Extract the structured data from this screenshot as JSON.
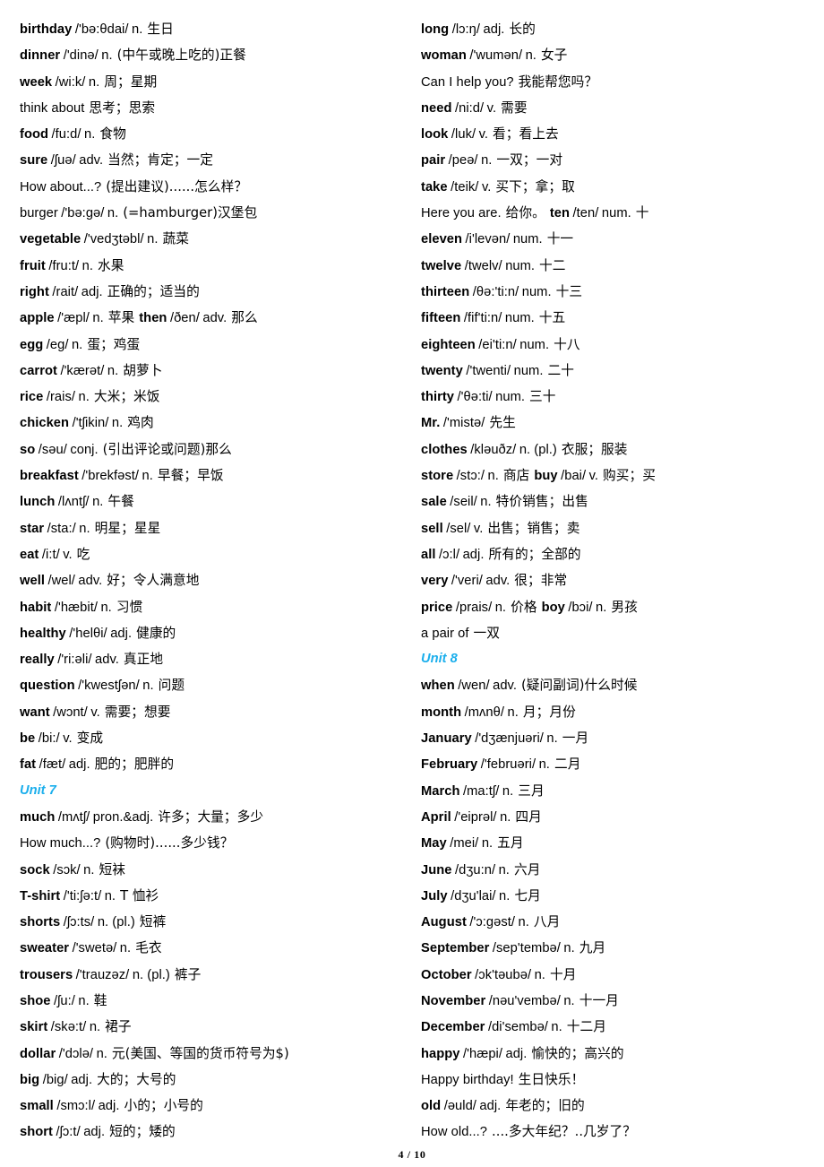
{
  "document": {
    "page_number_label": "4 / 10",
    "accent_color": "#1CAFEC",
    "text_color": "#000000",
    "background_color": "#FFFFFF"
  },
  "left_column": [
    {
      "type": "entry",
      "word": "birthday",
      "phonetic": "/'bə:θdai/",
      "pos": "n.",
      "cn": "生日"
    },
    {
      "type": "entry",
      "word": "dinner",
      "phonetic": "/'dinə/",
      "pos": "n.",
      "cn": "(中午或晚上吃的)正餐"
    },
    {
      "type": "entry",
      "word": "week",
      "phonetic": "/wi:k/",
      "pos": "n.",
      "cn": "周；星期"
    },
    {
      "type": "phrase",
      "word": "think about",
      "cn": "思考；思索"
    },
    {
      "type": "entry",
      "word": "food",
      "phonetic": "/fu:d/",
      "pos": "n.",
      "cn": "食物"
    },
    {
      "type": "entry",
      "word": "sure",
      "phonetic": "/ʃuə/",
      "pos": "adv.",
      "cn": "当然；肯定；一定"
    },
    {
      "type": "phrase",
      "word": "How about...?",
      "cn": "(提出建议)......怎么样？"
    },
    {
      "type": "plain",
      "word": "burger",
      "phonetic": "/'bə:gə/",
      "pos": "n.",
      "cn": "(=hamburger)汉堡包"
    },
    {
      "type": "entry",
      "word": "vegetable",
      "phonetic": "/'vedʒtəbl/",
      "pos": "n.",
      "cn": "蔬菜"
    },
    {
      "type": "entry",
      "word": "fruit",
      "phonetic": "/fru:t/",
      "pos": "n.",
      "cn": "水果"
    },
    {
      "type": "entry",
      "word": "right",
      "phonetic": "/rait/",
      "pos": "adj.",
      "cn": "正确的；适当的"
    },
    {
      "type": "double",
      "word": "apple",
      "phonetic": "/'æpl/",
      "pos": "n.",
      "cn": "苹果",
      "word2": "then",
      "phonetic2": "/ðen/",
      "pos2": "adv.",
      "cn2": "那么"
    },
    {
      "type": "entry",
      "word": "egg",
      "phonetic": "/eg/",
      "pos": "n.",
      "cn": "蛋；鸡蛋"
    },
    {
      "type": "entry",
      "word": "carrot",
      "phonetic": "/'kærət/",
      "pos": "n.",
      "cn": "胡萝卜"
    },
    {
      "type": "entry",
      "word": "rice",
      "phonetic": "/rais/",
      "pos": "n.",
      "cn": "大米；米饭"
    },
    {
      "type": "entry",
      "word": "chicken",
      "phonetic": "/'tʃikin/",
      "pos": "n.",
      "cn": "鸡肉"
    },
    {
      "type": "entry",
      "word": "so",
      "phonetic": "/səu/",
      "pos": "conj.",
      "cn": "(引出评论或问题)那么"
    },
    {
      "type": "entry",
      "word": "breakfast",
      "phonetic": "/'brekfəst/",
      "pos": "n.",
      "cn": "早餐；早饭"
    },
    {
      "type": "entry",
      "word": "lunch",
      "phonetic": "/lʌntʃ/",
      "pos": "n.",
      "cn": "午餐"
    },
    {
      "type": "entry",
      "word": "star",
      "phonetic": "/sta:/",
      "pos": "n.",
      "cn": "明星；星星"
    },
    {
      "type": "entry",
      "word": "eat",
      "phonetic": "/i:t/",
      "pos": "v.",
      "cn": "吃"
    },
    {
      "type": "entry",
      "word": "well",
      "phonetic": "/wel/",
      "pos": "adv.",
      "cn": "好；令人满意地"
    },
    {
      "type": "entry",
      "word": "habit",
      "phonetic": "/'hæbit/",
      "pos": "n.",
      "cn": "习惯"
    },
    {
      "type": "entry",
      "word": "healthy",
      "phonetic": "/'helθi/",
      "pos": "adj.",
      "cn": "健康的"
    },
    {
      "type": "entry",
      "word": "really",
      "phonetic": "/'ri:əli/",
      "pos": "adv.",
      "cn": "真正地"
    },
    {
      "type": "entry",
      "word": "question",
      "phonetic": "/'kwestʃən/",
      "pos": "n.",
      "cn": "问题"
    },
    {
      "type": "entry",
      "word": "want",
      "phonetic": "/wɔnt/",
      "pos": "v.",
      "cn": "需要；想要"
    },
    {
      "type": "entry",
      "word": "be",
      "phonetic": "/bi:/",
      "pos": "v.",
      "cn": "变成"
    },
    {
      "type": "entry",
      "word": "fat",
      "phonetic": "/fæt/",
      "pos": "adj.",
      "cn": "肥的；肥胖的"
    },
    {
      "type": "unit",
      "label": "Unit 7"
    },
    {
      "type": "entry",
      "word": "much",
      "phonetic": "/mʌtʃ/",
      "pos": "pron.&adj.",
      "cn": "许多；大量；多少"
    },
    {
      "type": "phrase",
      "word": "How much...?",
      "cn": "(购物时)......多少钱？"
    },
    {
      "type": "entry",
      "word": "sock",
      "phonetic": "/sɔk/",
      "pos": "n.",
      "cn": "短袜"
    },
    {
      "type": "entry",
      "word": "T-shirt",
      "phonetic": "/'ti:ʃə:t/",
      "pos": "n.",
      "cn": "T 恤衫"
    },
    {
      "type": "entry",
      "word": "shorts",
      "phonetic": "/ʃɔ:ts/",
      "pos": "n. (pl.)",
      "cn": "短裤"
    },
    {
      "type": "entry",
      "word": "sweater",
      "phonetic": "/'swetə/",
      "pos": "n.",
      "cn": "毛衣"
    },
    {
      "type": "entry",
      "word": "trousers",
      "phonetic": "/'trauzəz/",
      "pos": "n. (pl.)",
      "cn": "裤子"
    },
    {
      "type": "entry",
      "word": "shoe",
      "phonetic": "/ʃu:/",
      "pos": "n.",
      "cn": "鞋"
    },
    {
      "type": "entry",
      "word": "skirt",
      "phonetic": "/skə:t/",
      "pos": "n.",
      "cn": "裙子"
    },
    {
      "type": "entry",
      "word": "dollar",
      "phonetic": "/'dɔlə/",
      "pos": "n.",
      "cn": "元(美国、等国的货币符号为$)"
    },
    {
      "type": "entry",
      "word": "big",
      "phonetic": "/big/",
      "pos": "adj.",
      "cn": "大的；大号的"
    },
    {
      "type": "entry",
      "word": "small",
      "phonetic": "/smɔ:l/",
      "pos": "adj.",
      "cn": "小的；小号的"
    },
    {
      "type": "entry",
      "word": "short",
      "phonetic": "/ʃɔ:t/",
      "pos": "adj.",
      "cn": "短的；矮的"
    }
  ],
  "right_column": [
    {
      "type": "entry",
      "word": "long",
      "phonetic": "/lɔ:ŋ/",
      "pos": "adj.",
      "cn": "长的"
    },
    {
      "type": "entry",
      "word": "woman",
      "phonetic": "/'wumən/",
      "pos": "n.",
      "cn": "女子"
    },
    {
      "type": "phrase",
      "word": "Can I help you?",
      "cn": "我能帮您吗？"
    },
    {
      "type": "entry",
      "word": "need",
      "phonetic": "/ni:d/",
      "pos": "v.",
      "cn": "需要"
    },
    {
      "type": "entry",
      "word": "look",
      "phonetic": "/luk/",
      "pos": "v.",
      "cn": "看；看上去"
    },
    {
      "type": "entry",
      "word": "pair",
      "phonetic": "/peə/",
      "pos": "n.",
      "cn": "一双；一对"
    },
    {
      "type": "entry",
      "word": "take",
      "phonetic": "/teik/",
      "pos": "v.",
      "cn": "买下；拿；取"
    },
    {
      "type": "phrase_double",
      "word": "Here you are.",
      "cn": "给你。",
      "word2": "ten",
      "phonetic2": "/ten/",
      "pos2": "num.",
      "cn2": "十"
    },
    {
      "type": "entry",
      "word": "eleven",
      "phonetic": "/i'levən/",
      "pos": "num.",
      "cn": "十一"
    },
    {
      "type": "entry",
      "word": "twelve",
      "phonetic": "/twelv/",
      "pos": "num.",
      "cn": "十二"
    },
    {
      "type": "entry",
      "word": "thirteen",
      "phonetic": "/θə:'ti:n/",
      "pos": "num.",
      "cn": "十三"
    },
    {
      "type": "entry",
      "word": "fifteen",
      "phonetic": "/fif'ti:n/",
      "pos": "num.",
      "cn": "十五"
    },
    {
      "type": "entry",
      "word": "eighteen",
      "phonetic": "/ei'ti:n/",
      "pos": "num.",
      "cn": "十八"
    },
    {
      "type": "entry",
      "word": "twenty",
      "phonetic": "/'twenti/",
      "pos": "num.",
      "cn": "二十"
    },
    {
      "type": "entry",
      "word": "thirty",
      "phonetic": "/'θə:ti/",
      "pos": "num.",
      "cn": "三十"
    },
    {
      "type": "entry",
      "word": "Mr.",
      "phonetic": "/'mistə/",
      "pos": "",
      "cn": "先生"
    },
    {
      "type": "entry",
      "word": "clothes",
      "phonetic": "/kləuðz/",
      "pos": "n. (pl.)",
      "cn": "衣服；服装"
    },
    {
      "type": "double",
      "word": "store",
      "phonetic": "/stɔ:/",
      "pos": "n.",
      "cn": "商店",
      "word2": "buy",
      "phonetic2": "/bai/",
      "pos2": "v.",
      "cn2": "购买；买"
    },
    {
      "type": "entry",
      "word": "sale",
      "phonetic": "/seil/",
      "pos": "n.",
      "cn": "特价销售；出售"
    },
    {
      "type": "entry",
      "word": "sell",
      "phonetic": "/sel/",
      "pos": "v.",
      "cn": "出售；销售；卖"
    },
    {
      "type": "entry",
      "word": "all",
      "phonetic": "/ɔ:l/",
      "pos": "adj.",
      "cn": "所有的；全部的"
    },
    {
      "type": "entry",
      "word": "very",
      "phonetic": "/'veri/",
      "pos": "adv.",
      "cn": "很；非常"
    },
    {
      "type": "double",
      "word": "price",
      "phonetic": "/prais/",
      "pos": "n.",
      "cn": "价格",
      "word2": "boy",
      "phonetic2": "/bɔi/",
      "pos2": "n.",
      "cn2": "男孩"
    },
    {
      "type": "phrase",
      "word": "a pair of",
      "cn": "一双"
    },
    {
      "type": "unit",
      "label": "Unit 8"
    },
    {
      "type": "entry",
      "word": "when",
      "phonetic": "/wen/",
      "pos": "adv.",
      "cn": "(疑问副词)什么时候"
    },
    {
      "type": "entry",
      "word": "month",
      "phonetic": "/mʌnθ/",
      "pos": "n.",
      "cn": "月；月份"
    },
    {
      "type": "entry",
      "word": "January",
      "phonetic": "/'dʒænjuəri/",
      "pos": "n.",
      "cn": "一月"
    },
    {
      "type": "entry",
      "word": "February",
      "phonetic": "/'februəri/",
      "pos": "n.",
      "cn": "二月"
    },
    {
      "type": "entry",
      "word": "March",
      "phonetic": "/ma:tʃ/",
      "pos": "n.",
      "cn": "三月"
    },
    {
      "type": "entry",
      "word": "April",
      "phonetic": "/'eiprəl/",
      "pos": "n.",
      "cn": "四月"
    },
    {
      "type": "entry",
      "word": "May",
      "phonetic": "/mei/",
      "pos": "n.",
      "cn": "五月"
    },
    {
      "type": "entry",
      "word": "June",
      "phonetic": "/dʒu:n/",
      "pos": "n.",
      "cn": "六月"
    },
    {
      "type": "entry",
      "word": "July",
      "phonetic": "/dʒu'lai/",
      "pos": "n.",
      "cn": "七月"
    },
    {
      "type": "entry",
      "word": "August",
      "phonetic": "/'ɔ:gəst/",
      "pos": "n.",
      "cn": "八月"
    },
    {
      "type": "entry",
      "word": "September",
      "phonetic": "/sep'tembə/",
      "pos": "n.",
      "cn": "九月"
    },
    {
      "type": "entry",
      "word": "October",
      "phonetic": "/ɔk'təubə/",
      "pos": "n.",
      "cn": "十月"
    },
    {
      "type": "entry",
      "word": "November",
      "phonetic": "/nəu'vembə/",
      "pos": "n.",
      "cn": "十一月"
    },
    {
      "type": "entry",
      "word": "December",
      "phonetic": "/di'sembə/",
      "pos": "n.",
      "cn": "十二月"
    },
    {
      "type": "entry",
      "word": "happy",
      "phonetic": "/'hæpi/",
      "pos": "adj.",
      "cn": "愉快的；高兴的"
    },
    {
      "type": "phrase",
      "word": "Happy birthday!",
      "cn": "生日快乐！"
    },
    {
      "type": "entry",
      "word": "old",
      "phonetic": "/əuld/",
      "pos": "adj.",
      "cn": "年老的；旧的"
    },
    {
      "type": "phrase",
      "word": "How old...?",
      "cn": "....多大年纪？..几岁了？"
    }
  ]
}
